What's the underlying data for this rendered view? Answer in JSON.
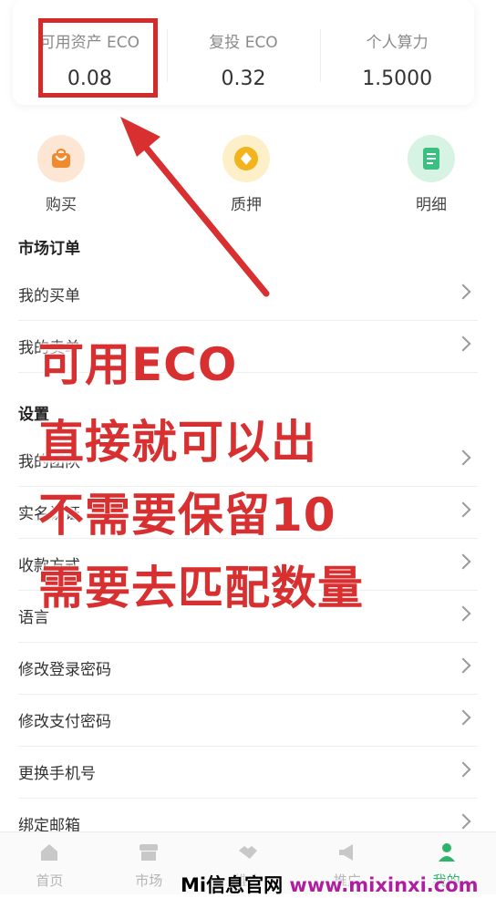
{
  "stats": [
    {
      "label": "可用资产 ECO",
      "value": "0.08"
    },
    {
      "label": "复投 ECO",
      "value": "0.32"
    },
    {
      "label": "个人算力",
      "value": "1.5000"
    }
  ],
  "quick_actions": [
    {
      "label": "购买",
      "icon": "shopping-bag-icon",
      "color": "#f08a2c"
    },
    {
      "label": "质押",
      "icon": "coin-icon",
      "color": "#f2b31c"
    },
    {
      "label": "明细",
      "icon": "document-icon",
      "color": "#3cc081"
    }
  ],
  "market_orders": {
    "title": "市场订单",
    "items": [
      "我的买单",
      "我的卖单"
    ]
  },
  "settings": {
    "title": "设置",
    "items": [
      "我的团队",
      "实名认证",
      "收款方式",
      "语言",
      "修改登录密码",
      "修改支付密码",
      "更换手机号",
      "绑定邮箱"
    ]
  },
  "annotation_lines": [
    "可用ECO",
    "直接就可以出",
    "不需要保留10",
    "需要去匹配数量"
  ],
  "tabbar": [
    {
      "label": "首页",
      "icon": "home-icon",
      "active": false
    },
    {
      "label": "市场",
      "icon": "market-icon",
      "active": false
    },
    {
      "label": "推广",
      "icon": "handshake-icon",
      "active": false
    },
    {
      "label": "推广",
      "icon": "megaphone-icon",
      "active": false
    },
    {
      "label": "我的",
      "icon": "person-icon",
      "active": true
    }
  ],
  "watermark": {
    "site": "Mi信息官网",
    "url": "www.mixinxi.com"
  },
  "colors": {
    "accent_green": "#2fb36b",
    "annotation_red": "#d83030",
    "tab_inactive": "#b5b5b5"
  }
}
